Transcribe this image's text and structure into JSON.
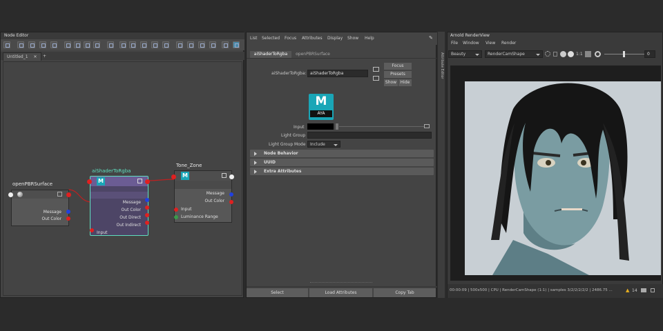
{
  "node_editor": {
    "title": "Node Editor",
    "tabs": [
      "Untitled_1",
      "+"
    ],
    "nodes": {
      "open_pbr": {
        "title": "openPBRSurface",
        "attrs": [
          "Message",
          "Out Color"
        ]
      },
      "shader_to_rgba": {
        "title": "aiShaderToRgba",
        "attrs": [
          "Message",
          "Out Color",
          "Out Direct",
          "Out Indirect",
          "Input"
        ],
        "icon_letter": "M"
      },
      "tone_zone": {
        "title": "Tone_Zone",
        "attrs": [
          "Message",
          "Out Color",
          "Input",
          "Luminance Range"
        ],
        "icon_letter": "M"
      }
    },
    "colors": {
      "shader_node": "#6a5a8a",
      "selected_border": "#5fe0c0",
      "port_red": "#e02020",
      "port_blue": "#2040e0"
    }
  },
  "attribute_editor": {
    "menu": [
      "List",
      "Selected",
      "Focus",
      "Attributes",
      "Display",
      "Show",
      "Help"
    ],
    "tabs": [
      "aiShaderToRgba",
      "openPBRSurface"
    ],
    "node_label": "aiShaderToRgba:",
    "node_name": "aiShaderToRgba",
    "buttons": {
      "focus": "Focus",
      "presets": "Presets",
      "show": "Show",
      "hide": "Hide"
    },
    "icon": {
      "letter": "M",
      "sub": "AYA"
    },
    "fields": {
      "input_label": "Input",
      "light_group_label": "Light Group",
      "light_group_mode_label": "Light Group Mode",
      "light_group_mode_value": "Include"
    },
    "frames": [
      "Node Behavior",
      "UUID",
      "Extra Attributes"
    ],
    "bottom_buttons": [
      "Select",
      "Load Attributes",
      "Copy Tab"
    ],
    "side_tab": "Attribute Editor"
  },
  "render_view": {
    "title": "Arnold RenderView",
    "menu": [
      "File",
      "Window",
      "View",
      "Render"
    ],
    "aov": "Beauty",
    "camera": "RenderCamShape",
    "ratio": "1:1",
    "exposure": "0",
    "status": "00:00:09 | 500x500 | CPU | RenderCamShape (1:1) | samples 3/2/2/2/2/2 | 2486.75 ...",
    "warnings": "14"
  }
}
